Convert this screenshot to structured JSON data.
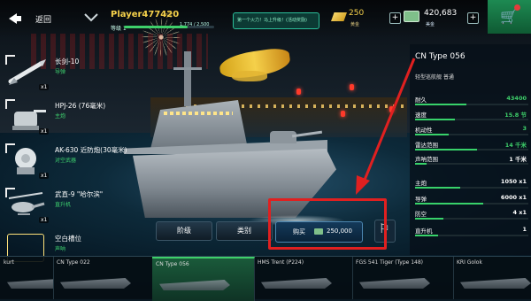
{
  "topbar": {
    "back_label": "返回",
    "player_name": "Player477420",
    "level_label": "等级 1",
    "xp_text": "1,774 / 2,500",
    "xp_progress": 0.71,
    "promo_text": "第一个火力！马上升级！(活动奖励)",
    "gold_value": "250",
    "gold_label": "黄金",
    "cash_value": "420,683",
    "cash_label": "美金",
    "plus_symbol": "+",
    "cart_icon": "cart-icon"
  },
  "weapons": [
    {
      "name": "长剑-10",
      "type": "导弹",
      "count": "x1",
      "icon": "missile-icon"
    },
    {
      "name": "HPJ-26 (76毫米)",
      "type": "主炮",
      "count": "x1",
      "icon": "naval-gun-icon"
    },
    {
      "name": "AK-630 近防炮(30毫米)",
      "type": "对空武器",
      "count": "x1",
      "icon": "ciws-icon"
    },
    {
      "name": "武直-9 \"哈尔滨\"",
      "type": "直升机",
      "count": "x1",
      "icon": "helicopter-icon"
    },
    {
      "name": "空白槽位",
      "type": "声呐",
      "count": "",
      "icon": "empty-slot-icon"
    }
  ],
  "ship_panel": {
    "title": "CN Type 056",
    "subtitle": "轻型巡航舰 普通",
    "stats": [
      {
        "label": "耐久",
        "value": "43400",
        "color": "#3ecf6a",
        "fill": 0.45
      },
      {
        "label": "速度",
        "value": "15.8 节",
        "color": "#3ecf6a",
        "fill": 0.35
      },
      {
        "label": "机动性",
        "value": "3",
        "color": "#3ecf6a",
        "fill": 0.3
      },
      {
        "label": "雷达范围",
        "value": "14 千米",
        "color": "#3ecf6a",
        "fill": 0.55
      },
      {
        "label": "声呐范围",
        "value": "1 千米",
        "color": "#ffffff",
        "fill": 0.1
      }
    ],
    "weapons": [
      {
        "label": "主炮",
        "value": "1050 x1",
        "color": "#ffffff",
        "fill": 0.4
      },
      {
        "label": "导弹",
        "value": "6000 x1",
        "color": "#ffffff",
        "fill": 0.6
      },
      {
        "label": "防空",
        "value": "4 x1",
        "color": "#ffffff",
        "fill": 0.25
      },
      {
        "label": "直升机",
        "value": "1",
        "color": "#ffffff",
        "fill": 0.2
      }
    ]
  },
  "controls": {
    "tier_label": "阶级",
    "category_label": "类别",
    "buy_label": "购买",
    "buy_price": "250,000",
    "test_icon": "flag-icon"
  },
  "carousel": [
    {
      "name": "kurt",
      "selected": false
    },
    {
      "name": "CN Type 022",
      "selected": false
    },
    {
      "name": "CN Type 056",
      "selected": true
    },
    {
      "name": "HMS Trent (P224)",
      "selected": false
    },
    {
      "name": "FGS 541 Tiger (Type 148)",
      "selected": false
    },
    {
      "name": "KRI Golok",
      "selected": false
    }
  ],
  "colors": {
    "accent_green": "#3ecf6a",
    "gold": "#f6d24b",
    "highlight_red": "#e02020"
  }
}
